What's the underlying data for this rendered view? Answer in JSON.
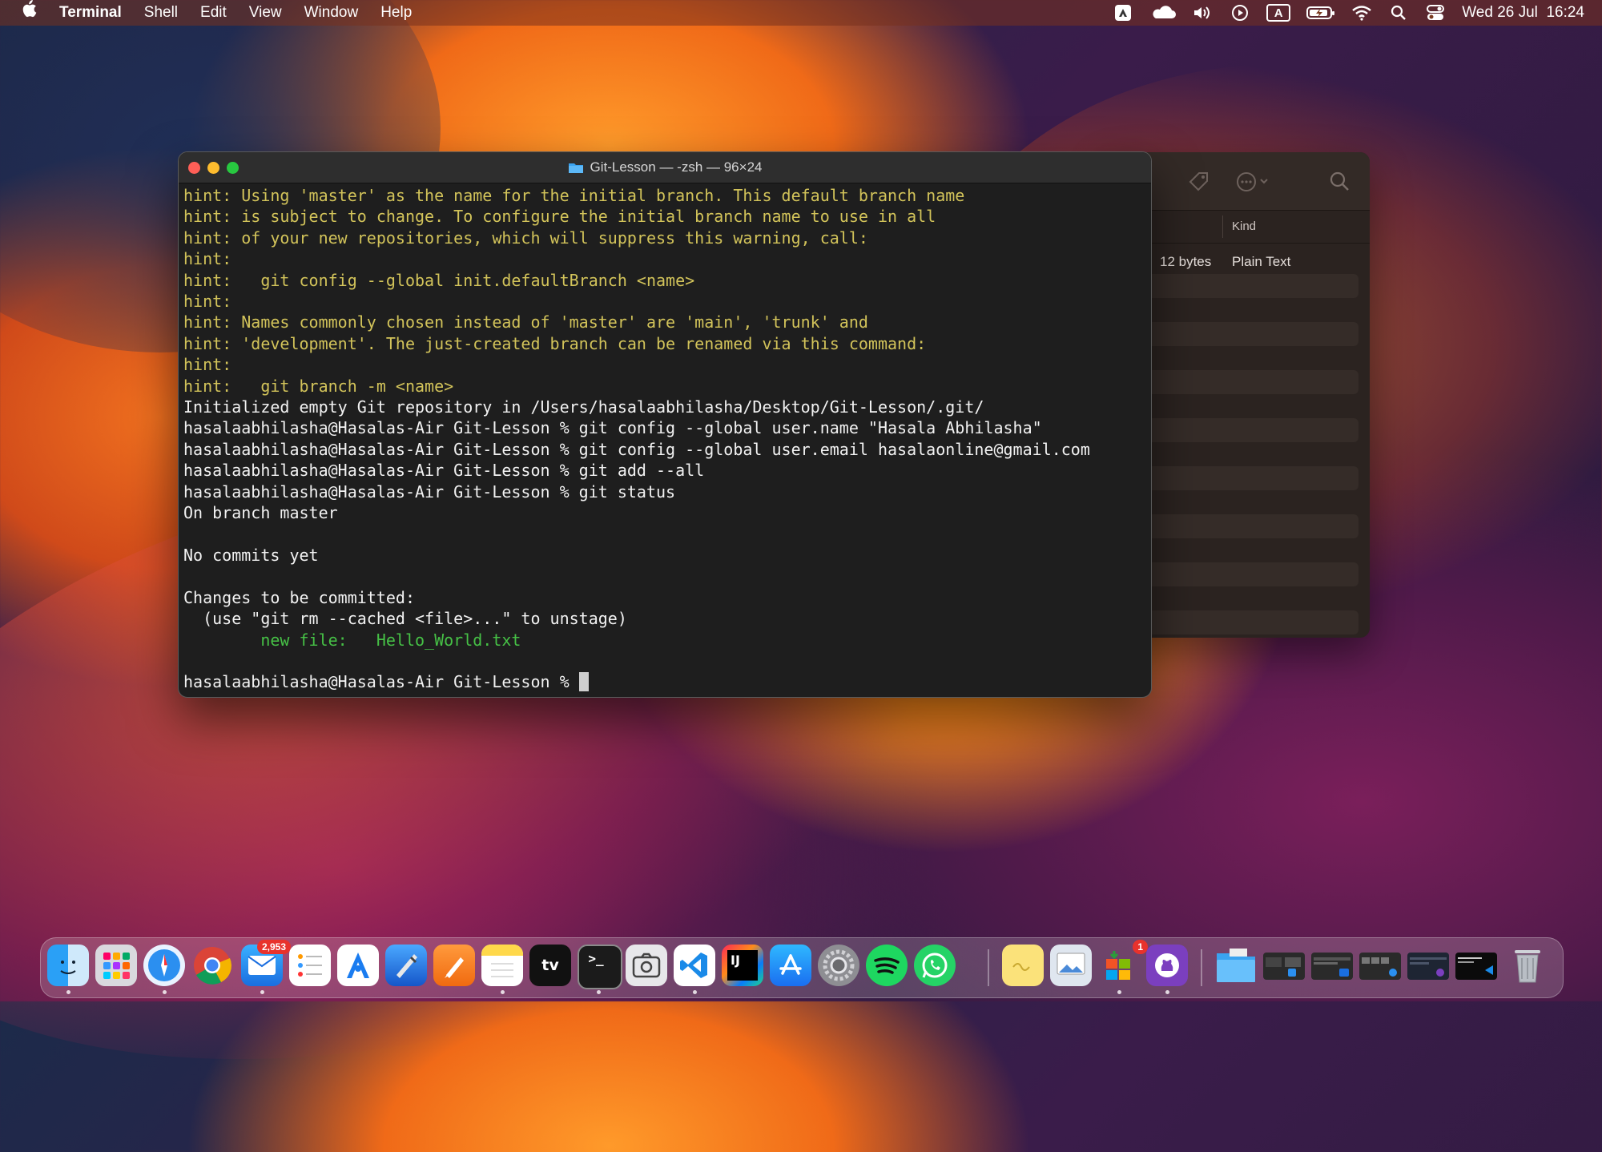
{
  "menubar": {
    "apple_icon": "apple-icon",
    "app_name": "Terminal",
    "menus": [
      "Shell",
      "Edit",
      "View",
      "Window",
      "Help"
    ],
    "status_icons": [
      "adobe-icon",
      "cloud-icon",
      "volume-icon",
      "play-icon",
      "input-a-icon",
      "battery-icon",
      "wifi-icon",
      "search-icon",
      "control-center-icon"
    ],
    "input_source": "A",
    "clock": "Wed 26 Jul  16:24"
  },
  "finder": {
    "column_kind": "Kind",
    "file_size": "12 bytes",
    "file_kind": "Plain Text"
  },
  "terminal": {
    "title": "Git-Lesson — -zsh — 96×24",
    "lines": [
      {
        "text": "hint: Using 'master' as the name for the initial branch. This default branch name",
        "style": "hint"
      },
      {
        "text": "hint: is subject to change. To configure the initial branch name to use in all",
        "style": "hint"
      },
      {
        "text": "hint: of your new repositories, which will suppress this warning, call:",
        "style": "hint"
      },
      {
        "text": "hint:",
        "style": "hint"
      },
      {
        "text": "hint:   git config --global init.defaultBranch <name>",
        "style": "hint"
      },
      {
        "text": "hint:",
        "style": "hint"
      },
      {
        "text": "hint: Names commonly chosen instead of 'master' are 'main', 'trunk' and",
        "style": "hint"
      },
      {
        "text": "hint: 'development'. The just-created branch can be renamed via this command:",
        "style": "hint"
      },
      {
        "text": "hint:",
        "style": "hint"
      },
      {
        "text": "hint:   git branch -m <name>",
        "style": "hint"
      },
      {
        "text": "Initialized empty Git repository in /Users/hasalaabhilasha/Desktop/Git-Lesson/.git/",
        "style": "plain"
      },
      {
        "text": "hasalaabhilasha@Hasalas-Air Git-Lesson % git config --global user.name \"Hasala Abhilasha\"",
        "style": "plain"
      },
      {
        "text": "hasalaabhilasha@Hasalas-Air Git-Lesson % git config --global user.email hasalaonline@gmail.com",
        "style": "plain"
      },
      {
        "text": "hasalaabhilasha@Hasalas-Air Git-Lesson % git add --all",
        "style": "plain"
      },
      {
        "text": "hasalaabhilasha@Hasalas-Air Git-Lesson % git status",
        "style": "plain"
      },
      {
        "text": "On branch master",
        "style": "plain"
      },
      {
        "text": "",
        "style": "plain"
      },
      {
        "text": "No commits yet",
        "style": "plain"
      },
      {
        "text": "",
        "style": "plain"
      },
      {
        "text": "Changes to be committed:",
        "style": "plain"
      },
      {
        "text": "  (use \"git rm --cached <file>...\" to unstage)",
        "style": "plain"
      },
      {
        "text": "        new file:   Hello_World.txt",
        "style": "green"
      },
      {
        "text": "",
        "style": "plain"
      }
    ],
    "prompt": "hasalaabhilasha@Hasalas-Air Git-Lesson % "
  },
  "dock": {
    "mail_badge": "2,953",
    "store_badge": "1",
    "intellij_label": "IJ",
    "tv_label": "tv",
    "terminal_label": ">_"
  }
}
